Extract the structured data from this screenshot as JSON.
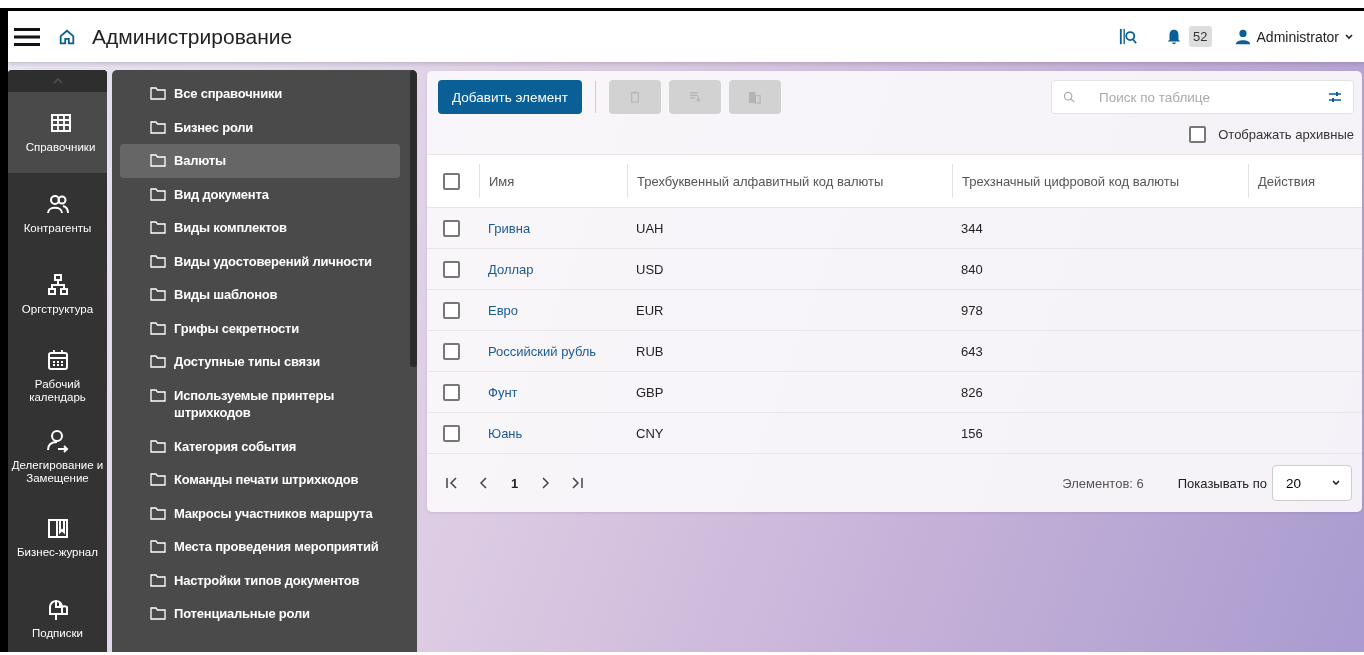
{
  "header": {
    "title": "Администрирование",
    "notifications_count": "52",
    "user": "Administrator"
  },
  "rail": {
    "items": [
      {
        "label": "Справочники",
        "selected": true
      },
      {
        "label": "Контрагенты",
        "selected": false
      },
      {
        "label": "Оргструктура",
        "selected": false
      },
      {
        "label": "Рабочий календарь",
        "selected": false
      },
      {
        "label": "Делегирование и Замещение",
        "selected": false
      },
      {
        "label": "Бизнес-журнал",
        "selected": false
      },
      {
        "label": "Подписки",
        "selected": false
      }
    ]
  },
  "catalogs": {
    "items": [
      {
        "label": "Все справочники",
        "selected": false
      },
      {
        "label": "Бизнес роли",
        "selected": false
      },
      {
        "label": "Валюты",
        "selected": true
      },
      {
        "label": "Вид документа",
        "selected": false
      },
      {
        "label": "Виды комплектов",
        "selected": false
      },
      {
        "label": "Виды удостоверений личности",
        "selected": false
      },
      {
        "label": "Виды шаблонов",
        "selected": false
      },
      {
        "label": "Грифы секретности",
        "selected": false
      },
      {
        "label": "Доступные типы связи",
        "selected": false
      },
      {
        "label": "Используемые принтеры штрихкодов",
        "selected": false
      },
      {
        "label": "Категория события",
        "selected": false
      },
      {
        "label": "Команды печати штрихкодов",
        "selected": false
      },
      {
        "label": "Макросы участников маршрута",
        "selected": false
      },
      {
        "label": "Места проведения мероприятий",
        "selected": false
      },
      {
        "label": "Настройки типов документов",
        "selected": false
      },
      {
        "label": "Потенциальные роли",
        "selected": false
      }
    ]
  },
  "toolbar": {
    "add_button": "Добавить элемент",
    "search": {
      "placeholder": "Поиск по таблице"
    },
    "show_archived": {
      "label": "Отображать архивные",
      "checked": false
    }
  },
  "table": {
    "select_all": {
      "checked": false
    },
    "columns": [
      "Имя",
      "Трехбуквенный алфавитный код валюты",
      "Трехзначный цифровой код валюты",
      "Действия"
    ],
    "rows": [
      {
        "name": "Гривна",
        "alpha_code": "UAH",
        "numeric_code": "344",
        "checked": false
      },
      {
        "name": "Доллар",
        "alpha_code": "USD",
        "numeric_code": "840",
        "checked": false
      },
      {
        "name": "Евро",
        "alpha_code": "EUR",
        "numeric_code": "978",
        "checked": false
      },
      {
        "name": "Российский рубль",
        "alpha_code": "RUB",
        "numeric_code": "643",
        "checked": false
      },
      {
        "name": "Фунт",
        "alpha_code": "GBP",
        "numeric_code": "826",
        "checked": false
      },
      {
        "name": "Юань",
        "alpha_code": "CNY",
        "numeric_code": "156",
        "checked": false
      }
    ]
  },
  "pagination": {
    "page": "1",
    "count": "Элементов: 6",
    "page_size_label": "Показывать по",
    "page_size": "20"
  }
}
